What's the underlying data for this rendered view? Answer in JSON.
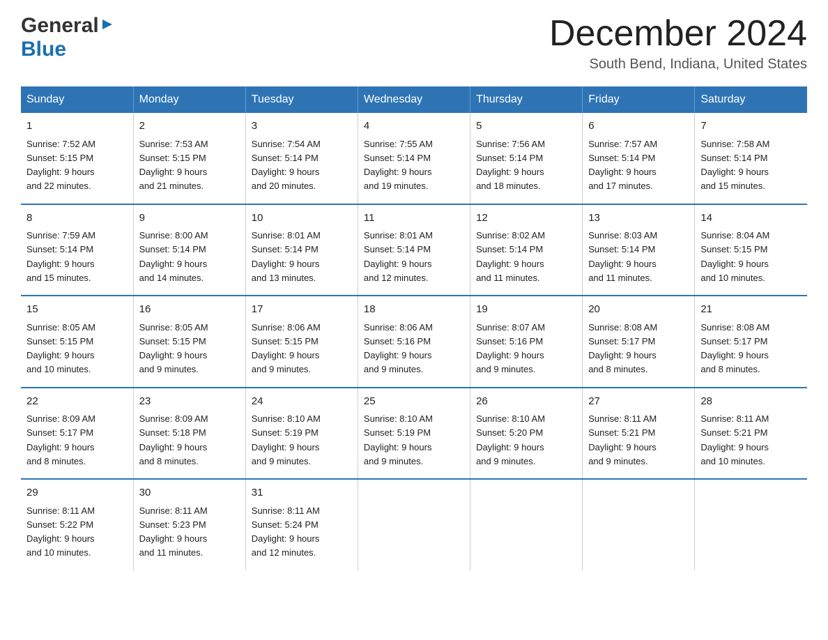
{
  "logo": {
    "general": "General",
    "blue": "Blue"
  },
  "title": "December 2024",
  "location": "South Bend, Indiana, United States",
  "days_of_week": [
    "Sunday",
    "Monday",
    "Tuesday",
    "Wednesday",
    "Thursday",
    "Friday",
    "Saturday"
  ],
  "weeks": [
    [
      {
        "day": "1",
        "sunrise": "7:52 AM",
        "sunset": "5:15 PM",
        "daylight": "9 hours and 22 minutes."
      },
      {
        "day": "2",
        "sunrise": "7:53 AM",
        "sunset": "5:15 PM",
        "daylight": "9 hours and 21 minutes."
      },
      {
        "day": "3",
        "sunrise": "7:54 AM",
        "sunset": "5:14 PM",
        "daylight": "9 hours and 20 minutes."
      },
      {
        "day": "4",
        "sunrise": "7:55 AM",
        "sunset": "5:14 PM",
        "daylight": "9 hours and 19 minutes."
      },
      {
        "day": "5",
        "sunrise": "7:56 AM",
        "sunset": "5:14 PM",
        "daylight": "9 hours and 18 minutes."
      },
      {
        "day": "6",
        "sunrise": "7:57 AM",
        "sunset": "5:14 PM",
        "daylight": "9 hours and 17 minutes."
      },
      {
        "day": "7",
        "sunrise": "7:58 AM",
        "sunset": "5:14 PM",
        "daylight": "9 hours and 15 minutes."
      }
    ],
    [
      {
        "day": "8",
        "sunrise": "7:59 AM",
        "sunset": "5:14 PM",
        "daylight": "9 hours and 15 minutes."
      },
      {
        "day": "9",
        "sunrise": "8:00 AM",
        "sunset": "5:14 PM",
        "daylight": "9 hours and 14 minutes."
      },
      {
        "day": "10",
        "sunrise": "8:01 AM",
        "sunset": "5:14 PM",
        "daylight": "9 hours and 13 minutes."
      },
      {
        "day": "11",
        "sunrise": "8:01 AM",
        "sunset": "5:14 PM",
        "daylight": "9 hours and 12 minutes."
      },
      {
        "day": "12",
        "sunrise": "8:02 AM",
        "sunset": "5:14 PM",
        "daylight": "9 hours and 11 minutes."
      },
      {
        "day": "13",
        "sunrise": "8:03 AM",
        "sunset": "5:14 PM",
        "daylight": "9 hours and 11 minutes."
      },
      {
        "day": "14",
        "sunrise": "8:04 AM",
        "sunset": "5:15 PM",
        "daylight": "9 hours and 10 minutes."
      }
    ],
    [
      {
        "day": "15",
        "sunrise": "8:05 AM",
        "sunset": "5:15 PM",
        "daylight": "9 hours and 10 minutes."
      },
      {
        "day": "16",
        "sunrise": "8:05 AM",
        "sunset": "5:15 PM",
        "daylight": "9 hours and 9 minutes."
      },
      {
        "day": "17",
        "sunrise": "8:06 AM",
        "sunset": "5:15 PM",
        "daylight": "9 hours and 9 minutes."
      },
      {
        "day": "18",
        "sunrise": "8:06 AM",
        "sunset": "5:16 PM",
        "daylight": "9 hours and 9 minutes."
      },
      {
        "day": "19",
        "sunrise": "8:07 AM",
        "sunset": "5:16 PM",
        "daylight": "9 hours and 9 minutes."
      },
      {
        "day": "20",
        "sunrise": "8:08 AM",
        "sunset": "5:17 PM",
        "daylight": "9 hours and 8 minutes."
      },
      {
        "day": "21",
        "sunrise": "8:08 AM",
        "sunset": "5:17 PM",
        "daylight": "9 hours and 8 minutes."
      }
    ],
    [
      {
        "day": "22",
        "sunrise": "8:09 AM",
        "sunset": "5:17 PM",
        "daylight": "9 hours and 8 minutes."
      },
      {
        "day": "23",
        "sunrise": "8:09 AM",
        "sunset": "5:18 PM",
        "daylight": "9 hours and 8 minutes."
      },
      {
        "day": "24",
        "sunrise": "8:10 AM",
        "sunset": "5:19 PM",
        "daylight": "9 hours and 9 minutes."
      },
      {
        "day": "25",
        "sunrise": "8:10 AM",
        "sunset": "5:19 PM",
        "daylight": "9 hours and 9 minutes."
      },
      {
        "day": "26",
        "sunrise": "8:10 AM",
        "sunset": "5:20 PM",
        "daylight": "9 hours and 9 minutes."
      },
      {
        "day": "27",
        "sunrise": "8:11 AM",
        "sunset": "5:21 PM",
        "daylight": "9 hours and 9 minutes."
      },
      {
        "day": "28",
        "sunrise": "8:11 AM",
        "sunset": "5:21 PM",
        "daylight": "9 hours and 10 minutes."
      }
    ],
    [
      {
        "day": "29",
        "sunrise": "8:11 AM",
        "sunset": "5:22 PM",
        "daylight": "9 hours and 10 minutes."
      },
      {
        "day": "30",
        "sunrise": "8:11 AM",
        "sunset": "5:23 PM",
        "daylight": "9 hours and 11 minutes."
      },
      {
        "day": "31",
        "sunrise": "8:11 AM",
        "sunset": "5:24 PM",
        "daylight": "9 hours and 12 minutes."
      },
      null,
      null,
      null,
      null
    ]
  ],
  "labels": {
    "sunrise": "Sunrise:",
    "sunset": "Sunset:",
    "daylight": "Daylight:"
  }
}
